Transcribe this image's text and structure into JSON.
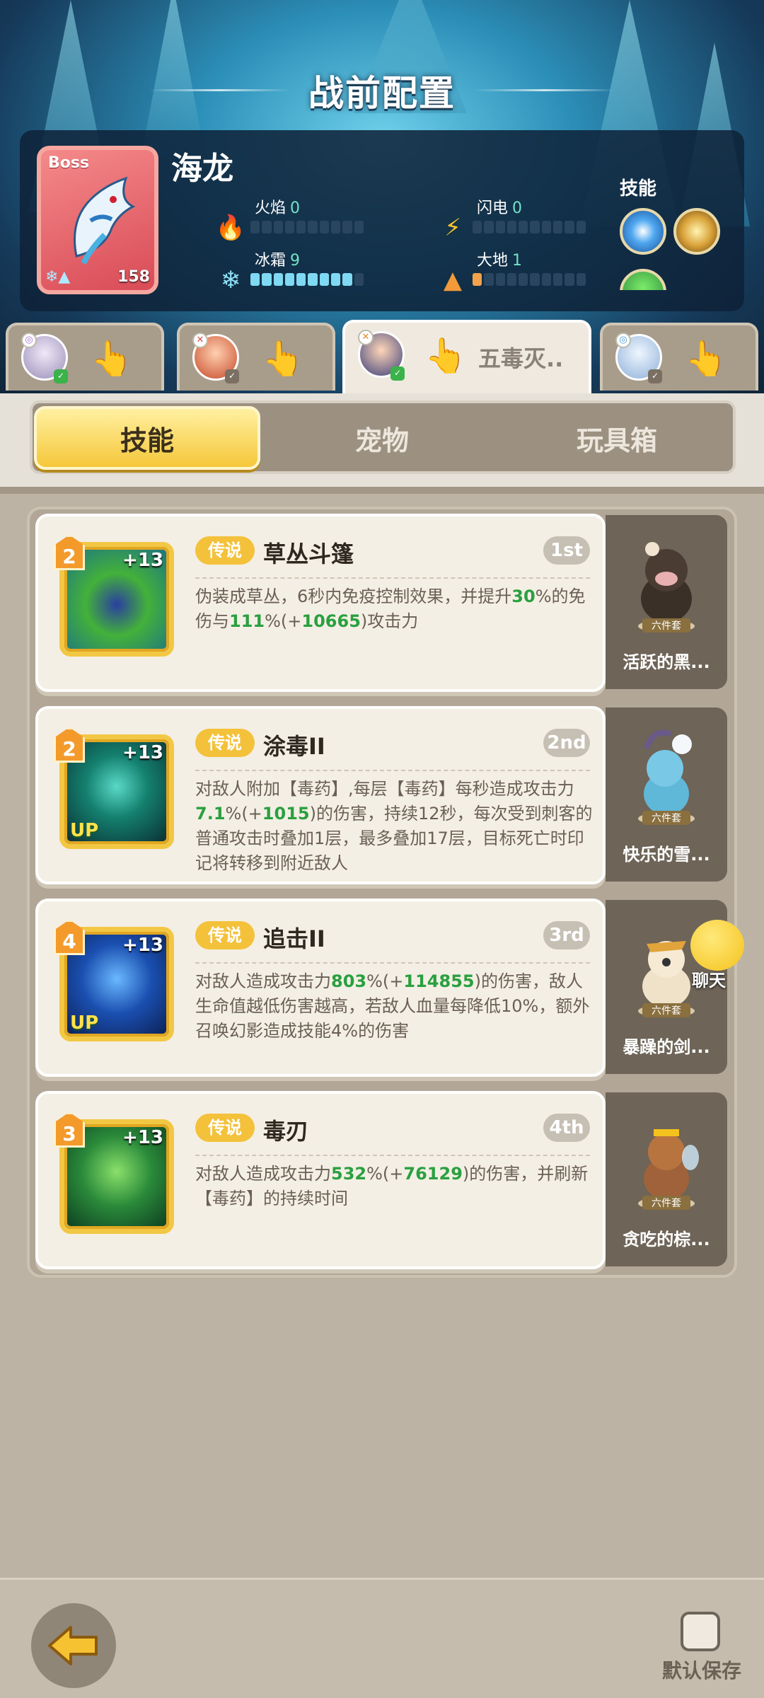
{
  "header": {
    "title": "战前配置"
  },
  "boss": {
    "tag": "Boss",
    "name": "海龙",
    "level": "158",
    "skills_label": "技能",
    "stats": [
      {
        "label": "火焰",
        "value": "0",
        "icon": "fire-icon"
      },
      {
        "label": "闪电",
        "value": "0",
        "icon": "lightning-icon"
      },
      {
        "label": "冰霜",
        "value": "9",
        "icon": "snowflake-icon"
      },
      {
        "label": "大地",
        "value": "1",
        "icon": "earth-icon"
      }
    ]
  },
  "hero_tabs": [
    {
      "label": "",
      "active": false
    },
    {
      "label": "",
      "active": false
    },
    {
      "label": "五毒灭..",
      "active": true
    },
    {
      "label": "",
      "active": false
    }
  ],
  "category_tabs": {
    "skills": "技能",
    "pets": "宠物",
    "toybox": "玩具箱"
  },
  "skills": [
    {
      "rarity": "传说",
      "name": "草丛斗篷",
      "order": "1st",
      "level": "2",
      "plus": "+13",
      "up": "",
      "desc": [
        "伪装成草丛，6秒内免疫控制效果，并提升",
        "30",
        "%的免伤与",
        "111",
        "%(+",
        "10665",
        ")攻击力"
      ],
      "pet": {
        "name": "活跃的黑...",
        "set": "六件套"
      }
    },
    {
      "rarity": "传说",
      "name": "涂毒II",
      "order": "2nd",
      "level": "2",
      "plus": "+13",
      "up": "UP",
      "desc": [
        "对敌人附加【毒药】,每层【毒药】每秒造成攻击力",
        "7.1",
        "%(+",
        "1015",
        ")的伤害，持续12秒，每次受到刺客的普通攻击时叠加1层，最多叠加17层，目标死亡时印记将转移到附近敌人"
      ],
      "pet": {
        "name": "快乐的雪...",
        "set": "六件套"
      }
    },
    {
      "rarity": "传说",
      "name": "追击II",
      "order": "3rd",
      "level": "4",
      "plus": "+13",
      "up": "UP",
      "desc": [
        "对敌人造成攻击力",
        "803",
        "%(+",
        "114855",
        ")的伤害，敌人生命值越低伤害越高，若敌人血量每降低10%，额外召唤幻影造成技能4%的伤害"
      ],
      "pet": {
        "name": "暴躁的剑...",
        "set": "六件套"
      }
    },
    {
      "rarity": "传说",
      "name": "毒刃",
      "order": "4th",
      "level": "3",
      "plus": "+13",
      "up": "",
      "desc": [
        "对敌人造成攻击力",
        "532",
        "%(+",
        "76129",
        ")的伤害，并刷新【毒药】的持续时间"
      ],
      "pet": {
        "name": "贪吃的棕...",
        "set": "六件套"
      }
    }
  ],
  "chat": {
    "label": "聊天"
  },
  "footer": {
    "save_label": "默认保存"
  }
}
